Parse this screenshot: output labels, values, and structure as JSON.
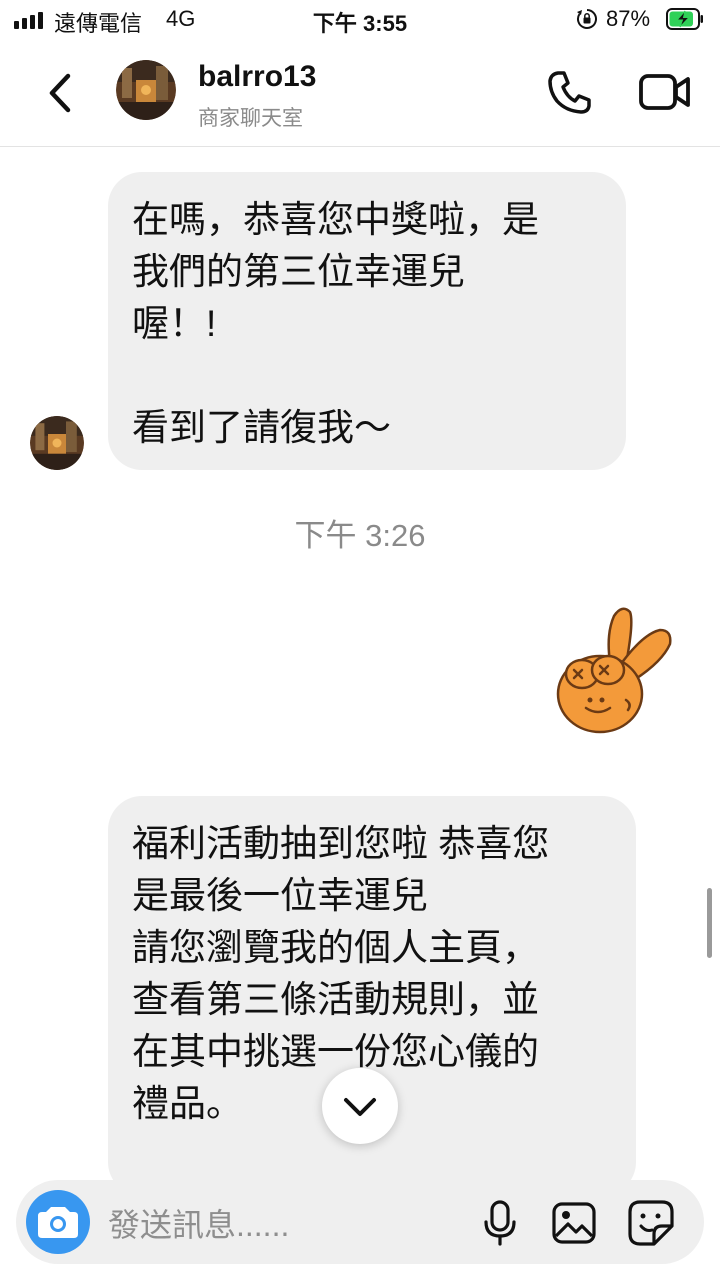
{
  "status_bar": {
    "carrier": "遠傳電信",
    "network": "4G",
    "time": "下午 3:55",
    "battery_percent": "87%",
    "battery_level": 0.87,
    "battery_color": "#30d158"
  },
  "header": {
    "back_icon": "chevron-left-icon",
    "username": "balrro13",
    "subtitle": "商家聊天室",
    "call_icon": "phone-icon",
    "video_icon": "video-camera-icon"
  },
  "messages": [
    {
      "sender": "balrro13",
      "text": "在嗎，恭喜您中獎啦，是\n我們的第三位幸運兒\n喔！!\n\n看到了請復我～"
    },
    {
      "type": "timestamp",
      "text": "下午 3:26"
    },
    {
      "sender": "self",
      "type": "sticker",
      "icon": "peace-hand-sticker-icon",
      "color": "#f39a3a"
    },
    {
      "sender": "balrro13",
      "text": "福利活動抽到您啦 恭喜您\n是最後一位幸運兒\n請您瀏覽我的個人主頁，\n查看第三條活動規則，並\n在其中挑選一份您心儀的\n禮品。"
    }
  ],
  "composer": {
    "placeholder": "發送訊息......",
    "camera_icon": "camera-icon",
    "mic_icon": "microphone-icon",
    "gallery_icon": "image-icon",
    "sticker_icon": "sticker-icon",
    "accent_color": "#3897f0"
  },
  "scroll_down_icon": "chevron-down-icon"
}
